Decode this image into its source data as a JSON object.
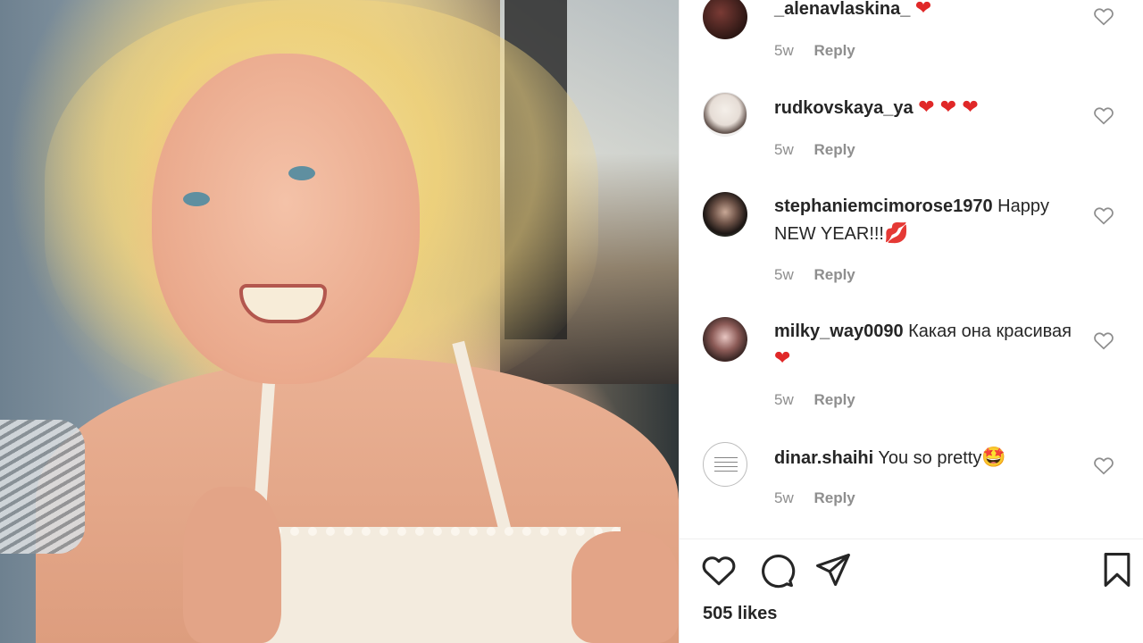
{
  "photo": {
    "alt": "photo-post"
  },
  "comments": [
    {
      "user": "_alenavlaskina_",
      "text": "",
      "emoji": "❤",
      "emoji_kind": "heart",
      "time": "5w",
      "reply": "Reply"
    },
    {
      "user": "rudkovskaya_ya",
      "text": "",
      "emoji": "❤ ❤ ❤",
      "emoji_kind": "heart",
      "time": "5w",
      "reply": "Reply"
    },
    {
      "user": "stephaniemcimorose1970",
      "text": "Happy NEW YEAR!!!",
      "emoji": "💋",
      "emoji_kind": "lips",
      "time": "5w",
      "reply": "Reply"
    },
    {
      "user": "milky_way0090",
      "text": "Какая она красивая",
      "emoji": "❤",
      "emoji_kind": "heart",
      "time": "5w",
      "reply": "Reply"
    },
    {
      "user": "dinar.shaihi",
      "text": "You so pretty",
      "emoji": "🤩",
      "emoji_kind": "star",
      "time": "5w",
      "reply": "Reply"
    }
  ],
  "actions": {
    "like_icon": "heart-outline-icon",
    "comment_icon": "comment-bubble-icon",
    "share_icon": "paper-plane-icon",
    "save_icon": "bookmark-icon"
  },
  "likes_text": "505 likes",
  "colors": {
    "text": "#262626",
    "muted": "#8e8e8e",
    "heart": "#e02828",
    "divider": "#efefef"
  }
}
